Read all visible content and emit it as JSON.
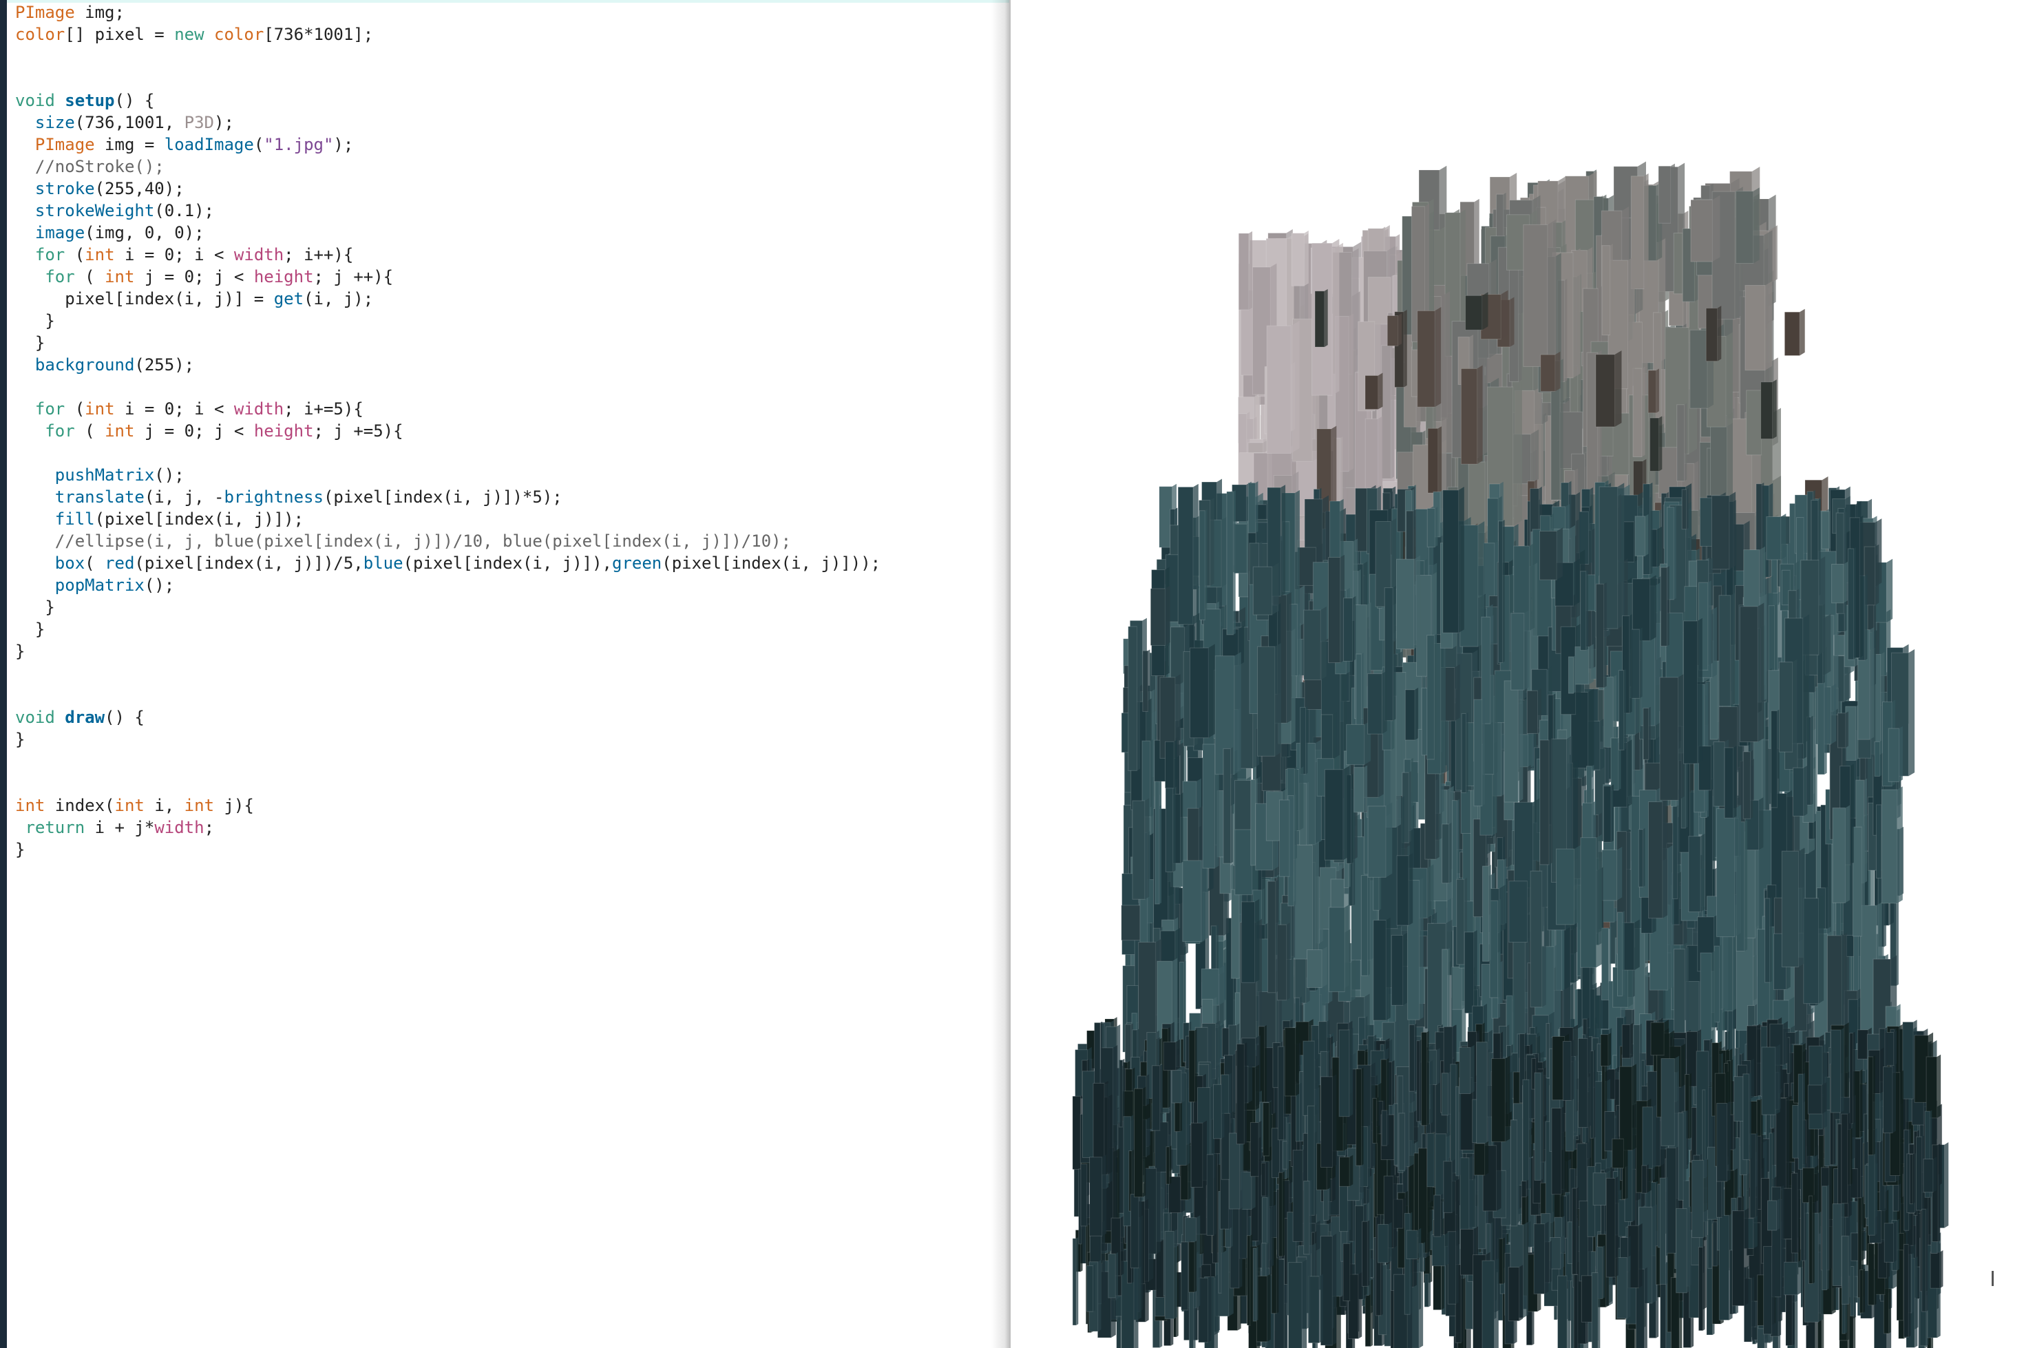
{
  "editor": {
    "lines": [
      [
        [
          "type",
          "PImage"
        ],
        [
          "plain",
          " img;"
        ]
      ],
      [
        [
          "type",
          "color"
        ],
        [
          "plain",
          "[] pixel = "
        ],
        [
          "kw",
          "new"
        ],
        [
          "plain",
          " "
        ],
        [
          "type",
          "color"
        ],
        [
          "plain",
          "[736*1001];"
        ]
      ],
      [],
      [],
      [
        [
          "kw",
          "void"
        ],
        [
          "plain",
          " "
        ],
        [
          "fnb",
          "setup"
        ],
        [
          "plain",
          "() {"
        ]
      ],
      [
        [
          "plain",
          "  "
        ],
        [
          "fn",
          "size"
        ],
        [
          "plain",
          "(736,1001, "
        ],
        [
          "p3d",
          "P3D"
        ],
        [
          "plain",
          ");"
        ]
      ],
      [
        [
          "plain",
          "  "
        ],
        [
          "type",
          "PImage"
        ],
        [
          "plain",
          " img = "
        ],
        [
          "fn",
          "loadImage"
        ],
        [
          "plain",
          "("
        ],
        [
          "str",
          "\"1.jpg\""
        ],
        [
          "plain",
          ");"
        ]
      ],
      [
        [
          "plain",
          "  "
        ],
        [
          "cmt",
          "//noStroke();"
        ]
      ],
      [
        [
          "plain",
          "  "
        ],
        [
          "fn",
          "stroke"
        ],
        [
          "plain",
          "(255,40);"
        ]
      ],
      [
        [
          "plain",
          "  "
        ],
        [
          "fn",
          "strokeWeight"
        ],
        [
          "plain",
          "(0.1);"
        ]
      ],
      [
        [
          "plain",
          "  "
        ],
        [
          "fn",
          "image"
        ],
        [
          "plain",
          "(img, 0, 0);"
        ]
      ],
      [
        [
          "plain",
          "  "
        ],
        [
          "kw",
          "for"
        ],
        [
          "plain",
          " ("
        ],
        [
          "type",
          "int"
        ],
        [
          "plain",
          " i = 0; i < "
        ],
        [
          "const",
          "width"
        ],
        [
          "plain",
          "; i++){"
        ]
      ],
      [
        [
          "plain",
          "   "
        ],
        [
          "kw",
          "for"
        ],
        [
          "plain",
          " ( "
        ],
        [
          "type",
          "int"
        ],
        [
          "plain",
          " j = 0; j < "
        ],
        [
          "const",
          "height"
        ],
        [
          "plain",
          "; j ++){"
        ]
      ],
      [
        [
          "plain",
          "     pixel[index(i, j)] = "
        ],
        [
          "fn",
          "get"
        ],
        [
          "plain",
          "(i, j);"
        ]
      ],
      [
        [
          "plain",
          "   }"
        ]
      ],
      [
        [
          "plain",
          "  }"
        ]
      ],
      [
        [
          "plain",
          "  "
        ],
        [
          "fn",
          "background"
        ],
        [
          "plain",
          "(255);"
        ]
      ],
      [],
      [
        [
          "plain",
          "  "
        ],
        [
          "kw",
          "for"
        ],
        [
          "plain",
          " ("
        ],
        [
          "type",
          "int"
        ],
        [
          "plain",
          " i = 0; i < "
        ],
        [
          "const",
          "width"
        ],
        [
          "plain",
          "; i+=5){"
        ]
      ],
      [
        [
          "plain",
          "   "
        ],
        [
          "kw",
          "for"
        ],
        [
          "plain",
          " ( "
        ],
        [
          "type",
          "int"
        ],
        [
          "plain",
          " j = 0; j < "
        ],
        [
          "const",
          "height"
        ],
        [
          "plain",
          "; j +=5){"
        ]
      ],
      [],
      [
        [
          "plain",
          "    "
        ],
        [
          "fn",
          "pushMatrix"
        ],
        [
          "plain",
          "();"
        ]
      ],
      [
        [
          "plain",
          "    "
        ],
        [
          "fn",
          "translate"
        ],
        [
          "plain",
          "(i, j, -"
        ],
        [
          "fn",
          "brightness"
        ],
        [
          "plain",
          "(pixel[index(i, j)])*5);"
        ]
      ],
      [
        [
          "plain",
          "    "
        ],
        [
          "fn",
          "fill"
        ],
        [
          "plain",
          "(pixel[index(i, j)]);"
        ]
      ],
      [
        [
          "plain",
          "    "
        ],
        [
          "cmt",
          "//ellipse(i, j, blue(pixel[index(i, j)])/10, blue(pixel[index(i, j)])/10);"
        ]
      ],
      [
        [
          "plain",
          "    "
        ],
        [
          "fn",
          "box"
        ],
        [
          "plain",
          "( "
        ],
        [
          "fn",
          "red"
        ],
        [
          "plain",
          "(pixel[index(i, j)])/5,"
        ],
        [
          "fn",
          "blue"
        ],
        [
          "plain",
          "(pixel[index(i, j)]),"
        ],
        [
          "fn",
          "green"
        ],
        [
          "plain",
          "(pixel[index(i, j)]));"
        ]
      ],
      [
        [
          "plain",
          "    "
        ],
        [
          "fn",
          "popMatrix"
        ],
        [
          "plain",
          "();"
        ]
      ],
      [
        [
          "plain",
          "   }"
        ]
      ],
      [
        [
          "plain",
          "  }"
        ]
      ],
      [
        [
          "plain",
          "}"
        ]
      ],
      [],
      [],
      [
        [
          "kw",
          "void"
        ],
        [
          "plain",
          " "
        ],
        [
          "fnb",
          "draw"
        ],
        [
          "plain",
          "() {"
        ]
      ],
      [
        [
          "plain",
          "}"
        ]
      ],
      [],
      [],
      [
        [
          "type",
          "int"
        ],
        [
          "plain",
          " index("
        ],
        [
          "type",
          "int"
        ],
        [
          "plain",
          " i, "
        ],
        [
          "type",
          "int"
        ],
        [
          "plain",
          " j){"
        ]
      ],
      [
        [
          "plain",
          " "
        ],
        [
          "kw",
          "return"
        ],
        [
          "plain",
          " i + j*"
        ],
        [
          "const",
          "width"
        ],
        [
          "plain",
          ";"
        ]
      ],
      [
        [
          "plain",
          "}"
        ]
      ]
    ],
    "current_line": 28
  },
  "sketch": {
    "background": "#ffffff",
    "palette": {
      "upper_light": [
        "#b9b0b3",
        "#a89fa2",
        "#c4bcbe",
        "#9e9799",
        "#b2aaab"
      ],
      "upper_mid": [
        "#7c7a78",
        "#6e706f",
        "#8a8683",
        "#5f6866",
        "#737873"
      ],
      "dark_accent": [
        "#3d3a36",
        "#4a403a",
        "#2f3532",
        "#544a44"
      ],
      "teal": [
        "#2f4a50",
        "#27434a",
        "#3a5a60",
        "#1f3940",
        "#34545a",
        "#2a3f45",
        "#456469"
      ],
      "bottom": [
        "#17262b",
        "#1c2f35",
        "#223a40",
        "#12201f",
        "#2a4248"
      ]
    }
  }
}
